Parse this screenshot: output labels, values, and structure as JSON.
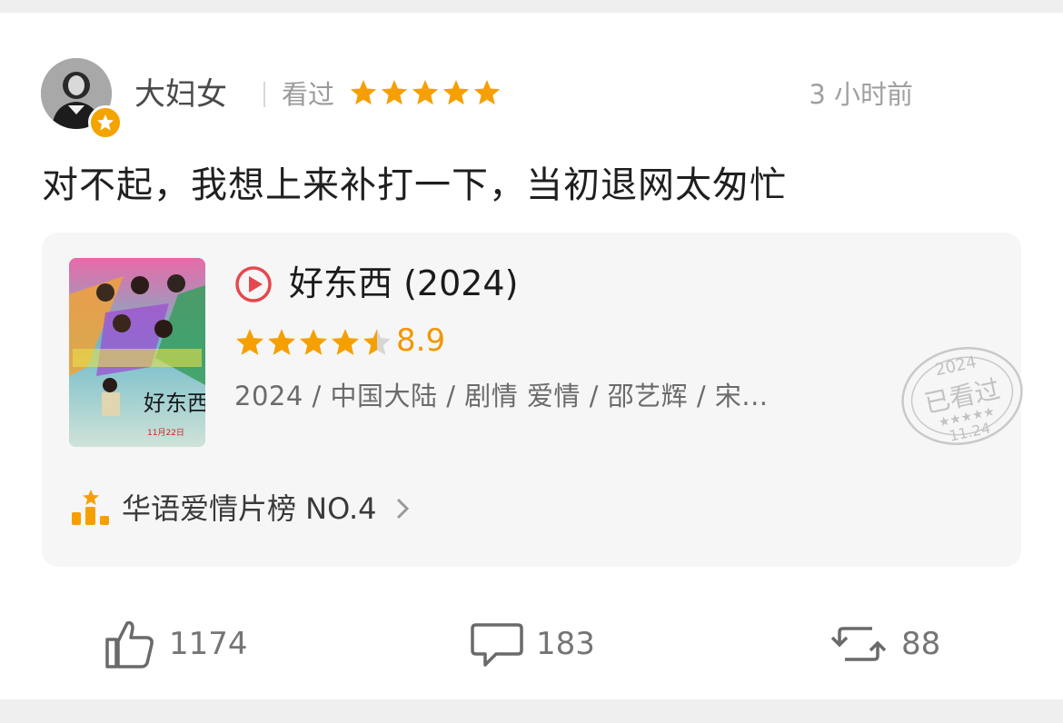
{
  "user": {
    "name": "大妇女",
    "status_label": "看过",
    "rating": 5,
    "timestamp": "3 小时前"
  },
  "comment": {
    "text": "对不起，我想上来补打一下，当初退网太匆忙"
  },
  "film": {
    "title": "好东西 (2024)",
    "rating": 4.5,
    "score": "8.9",
    "meta": "2024 / 中国大陆 / 剧情 爱情 / 邵艺辉 / 宋...",
    "poster_text": "好东西",
    "poster_date": "11月22日",
    "stamp": {
      "year": "2024",
      "label": "已看过",
      "date": "11.24"
    },
    "ranking": "华语爱情片榜 NO.4"
  },
  "actions": {
    "likes": "1174",
    "comments": "183",
    "reposts": "88"
  },
  "colors": {
    "star": "#f5a000",
    "accent_red": "#e5484d",
    "rank_orange": "#f5a000"
  }
}
